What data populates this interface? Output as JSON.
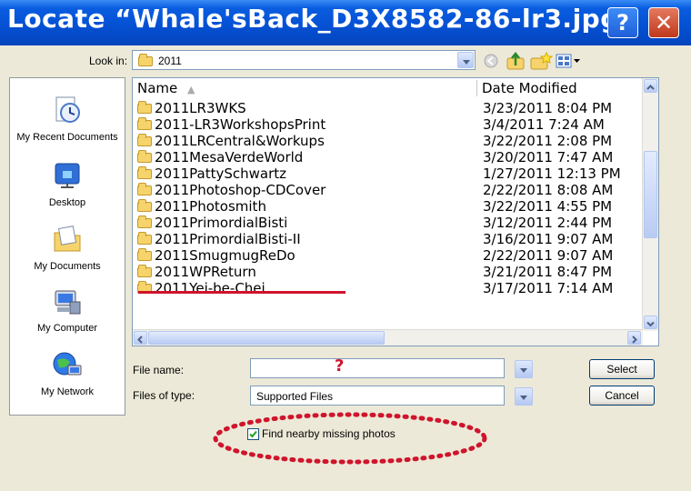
{
  "dialog": {
    "title": "Locate “Whale'sBack_D3X8582-86-lr3.jpg”",
    "help_label": "?",
    "close_label": "✕"
  },
  "lookin": {
    "label": "Look in:",
    "value": "2011"
  },
  "places": [
    {
      "label": "My Recent Documents",
      "icon": "recent-documents-icon"
    },
    {
      "label": "Desktop",
      "icon": "desktop-icon"
    },
    {
      "label": "My Documents",
      "icon": "my-documents-icon"
    },
    {
      "label": "My Computer",
      "icon": "my-computer-icon"
    },
    {
      "label": "My Network",
      "icon": "my-network-icon"
    }
  ],
  "list": {
    "columns": [
      "Name",
      "Date Modified"
    ],
    "rows": [
      {
        "name": "2011LR3WKS",
        "date": "3/23/2011 8:04 PM"
      },
      {
        "name": "2011-LR3WorkshopsPrint",
        "date": "3/4/2011 7:24 AM"
      },
      {
        "name": "2011LRCentral&Workups",
        "date": "3/22/2011 2:08 PM"
      },
      {
        "name": "2011MesaVerdeWorld",
        "date": "3/20/2011 7:47 AM"
      },
      {
        "name": "2011PattySchwartz",
        "date": "1/27/2011 12:13 PM"
      },
      {
        "name": "2011Photoshop-CDCover",
        "date": "2/22/2011 8:08 AM"
      },
      {
        "name": "2011Photosmith",
        "date": "3/22/2011 4:55 PM"
      },
      {
        "name": "2011PrimordialBisti",
        "date": "3/12/2011 2:44 PM"
      },
      {
        "name": "2011PrimordialBisti-II",
        "date": "3/16/2011 9:07 AM"
      },
      {
        "name": "2011SmugmugReDo",
        "date": "2/22/2011 9:07 AM"
      },
      {
        "name": "2011WPReturn",
        "date": "3/21/2011 8:47 PM"
      },
      {
        "name": "2011Yei-be-Chei",
        "date": "3/17/2011 7:14 AM"
      }
    ]
  },
  "filename": {
    "label": "File name:",
    "value": "",
    "annotation": "?"
  },
  "filetype": {
    "label": "Files of type:",
    "value": "Supported Files"
  },
  "buttons": {
    "select": "Select",
    "cancel": "Cancel"
  },
  "option": {
    "label": "Find nearby missing photos",
    "checked": true
  },
  "colors": {
    "title_bar": "#0551d4",
    "annotation_red": "#d0142c"
  }
}
